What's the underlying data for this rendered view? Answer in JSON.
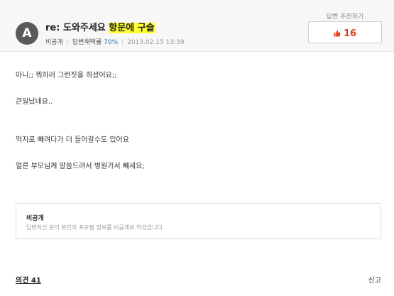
{
  "answer": {
    "avatar_letter": "A",
    "title_prefix": "re: 도와주세요 ",
    "title_highlight_1": "항문에",
    "title_space": " ",
    "title_highlight_2": "구슬",
    "author": "비공개",
    "adoption_label": "답변채택률 ",
    "adoption_rate": "70%",
    "date": "2013.02.15 13:39",
    "highlight_color": "#ffff33"
  },
  "recommend": {
    "label": "답변 추천하기",
    "count": "16",
    "icon": "thumbs-up-icon",
    "count_color": "#e2411d"
  },
  "content": {
    "lines": [
      "아니;; 뭐하러 그런짓을 하셨어요;;",
      "큰일났네요..",
      "억지로 빼려다가 더 들어갈수도 있어요",
      "얼른 부모님께 말씀드려서 병원가서 빼세요;"
    ]
  },
  "private_notice": {
    "title": "비공개",
    "description": "답변하신 분이 본인의 프로필 정보를 비공개로 하셨습니다."
  },
  "footer": {
    "comments_label": "의견 41",
    "report_label": "신고"
  }
}
